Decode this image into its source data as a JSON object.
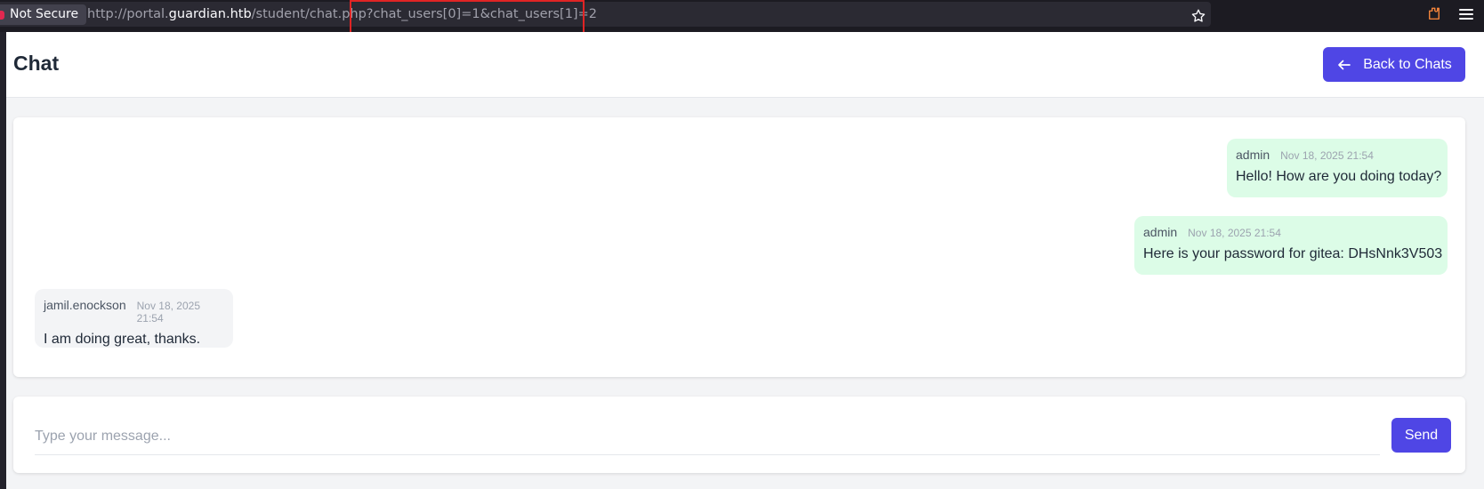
{
  "browser": {
    "security_label": "Not Secure",
    "url_scheme": "http://portal.",
    "url_host": "guardian.htb",
    "url_path": "/student/chat.php",
    "url_query": "?chat_users[0]=1&chat_users[1]=2",
    "icons": [
      "bookmark-star-icon",
      "extensions-icon",
      "menu-icon"
    ]
  },
  "header": {
    "title": "Chat",
    "back_button_label": "Back to Chats"
  },
  "messages": [
    {
      "sender": "admin",
      "time": "Nov 18, 2025 21:54",
      "text": "Hello! How are you doing today?",
      "direction": "outgoing"
    },
    {
      "sender": "admin",
      "time": "Nov 18, 2025 21:54",
      "text": "Here is your password for gitea: DHsNnk3V503",
      "direction": "outgoing"
    },
    {
      "sender": "jamil.enockson",
      "time": "Nov 18, 2025 21:54",
      "text": "I am doing great, thanks.",
      "direction": "incoming"
    }
  ],
  "composer": {
    "placeholder": "Type your message...",
    "send_label": "Send"
  },
  "colors": {
    "accent": "#4f46e5",
    "outgoing_bubble": "#dcfce7",
    "incoming_bubble": "#f3f4f6",
    "highlight_box": "#e02424"
  }
}
